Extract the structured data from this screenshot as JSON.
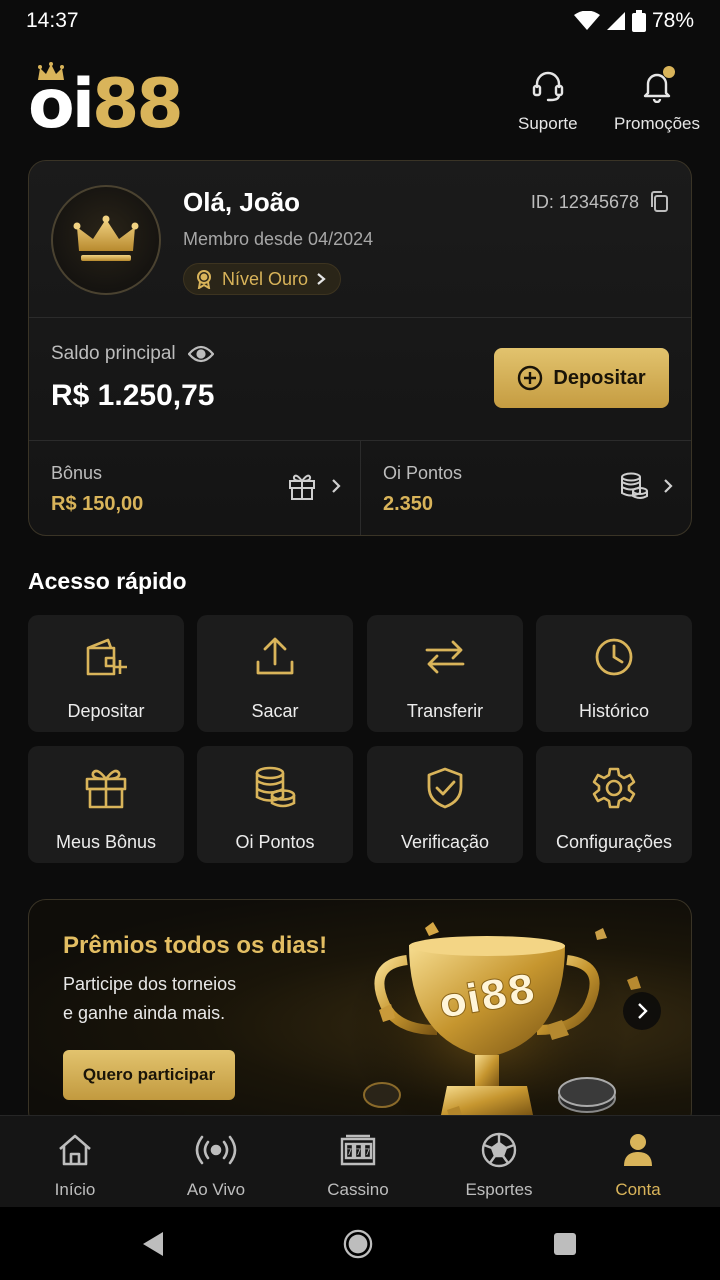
{
  "status_bar": {
    "time": "14:37",
    "battery": "78%"
  },
  "header": {
    "logo": {
      "part1": "oi",
      "part2": "88"
    },
    "support_label": "Suporte",
    "promotions_label": "Promoções"
  },
  "profile": {
    "greeting": "Olá, João",
    "member_since": "Membro desde 04/2024",
    "level": "Nível Ouro",
    "user_id": "ID: 12345678",
    "balance_label": "Saldo principal",
    "balance_value": "R$ 1.250,75",
    "deposit_label": "Depositar",
    "bonus_label": "Bônus",
    "bonus_value": "R$ 150,00",
    "points_label": "Oi Pontos",
    "points_value": "2.350"
  },
  "quick_access": {
    "title": "Acesso rápido",
    "items": [
      {
        "label": "Depositar",
        "icon": "wallet-plus-icon"
      },
      {
        "label": "Sacar",
        "icon": "upload-icon"
      },
      {
        "label": "Transferir",
        "icon": "transfer-arrows-icon"
      },
      {
        "label": "Histórico",
        "icon": "clock-icon"
      },
      {
        "label": "Meus Bônus",
        "icon": "gift-icon"
      },
      {
        "label": "Oi Pontos",
        "icon": "coins-icon"
      },
      {
        "label": "Verificação",
        "icon": "shield-check-icon"
      },
      {
        "label": "Configurações",
        "icon": "gear-icon"
      }
    ]
  },
  "promo": {
    "title": "Prêmios todos os dias!",
    "text_line1": "Participe dos torneios",
    "text_line2": "e ganhe ainda mais.",
    "button": "Quero participar",
    "trophy_text": "oi88"
  },
  "bottom_nav": {
    "items": [
      {
        "label": "Início",
        "icon": "home-icon"
      },
      {
        "label": "Ao Vivo",
        "icon": "live-broadcast-icon"
      },
      {
        "label": "Cassino",
        "icon": "slot-machine-icon"
      },
      {
        "label": "Esportes",
        "icon": "soccer-ball-icon"
      },
      {
        "label": "Conta",
        "icon": "user-icon"
      }
    ],
    "active_index": 4
  },
  "colors": {
    "background": "#0c0c0c",
    "gold": "#d9b45a",
    "card": "#1c1c1c",
    "text_muted": "#bdbdbd"
  }
}
